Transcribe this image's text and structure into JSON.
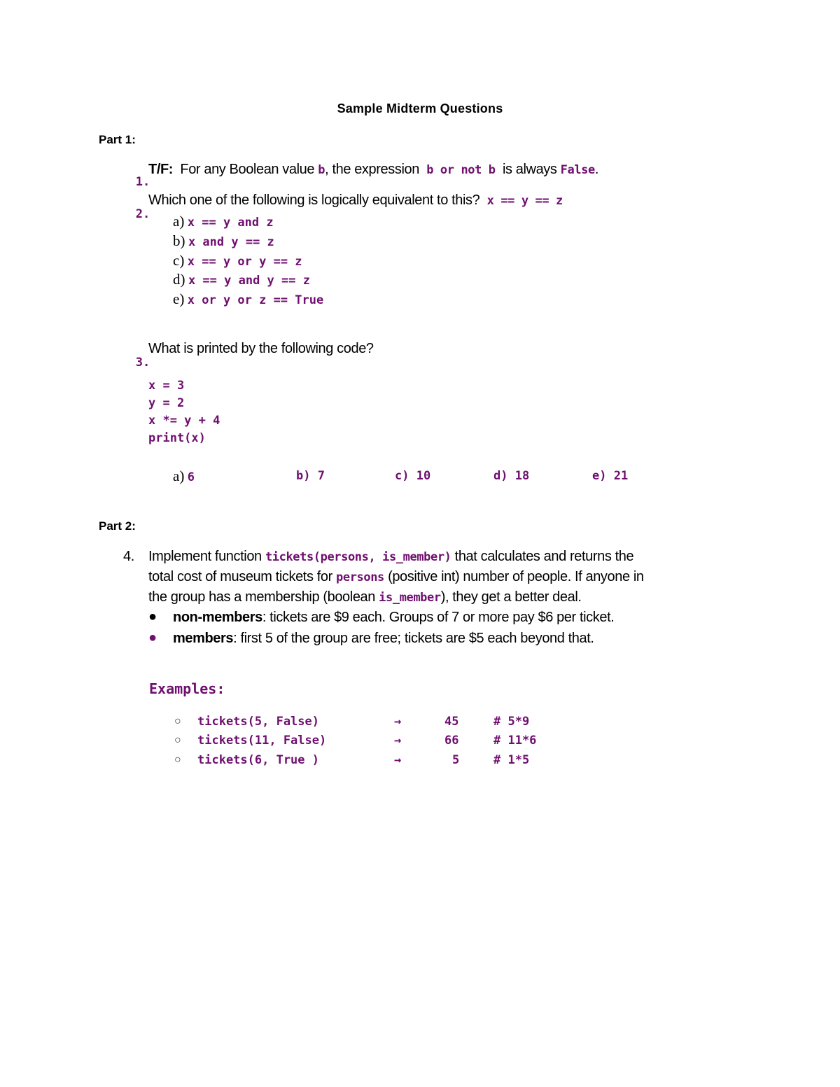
{
  "document": {
    "title": "Sample Midterm Questions",
    "part1_label": "Part 1:",
    "part2_label": "Part 2:"
  },
  "q1": {
    "number": "1.",
    "prefix": "T/F:",
    "text_a": "For any Boolean value",
    "code_b": "b",
    "text_b": ", the expression",
    "code_expr": "b or not b",
    "text_c": "is always",
    "code_false": "False",
    "text_d": "."
  },
  "q2": {
    "number": "2.",
    "text": "Which one of the following is logically equivalent to this?",
    "code_expr": "x == y == z",
    "options": [
      {
        "letter": "a)",
        "code": "x == y and z"
      },
      {
        "letter": "b)",
        "code": "x and y == z"
      },
      {
        "letter": "c)",
        "code": "x == y or y == z"
      },
      {
        "letter": "d)",
        "code": "x == y and y == z"
      },
      {
        "letter": "e)",
        "code": "x or y or z == True"
      }
    ]
  },
  "q3": {
    "number": "3.",
    "text": "What is printed by the following code?",
    "code_lines": [
      "x = 3",
      "y = 2",
      "x *= y + 4",
      "print(x)"
    ],
    "answers": [
      {
        "letter": "a)",
        "value": "6"
      },
      {
        "letter": "b)",
        "value": "7"
      },
      {
        "letter": "c)",
        "value": "10"
      },
      {
        "letter": "d)",
        "value": "18"
      },
      {
        "letter": "e)",
        "value": "21"
      }
    ]
  },
  "q4": {
    "number": "4.",
    "line1_text": "Implement function",
    "line1_code": "tickets(persons, is_member)",
    "line1_tail": "that calculates and returns the",
    "line2_text": "total cost of museum tickets for",
    "line2_code": "persons",
    "line2_tail": "(positive int) number of people. If anyone in",
    "line3_text": "the group has a membership (boolean",
    "line3_code": "is_member",
    "line3_tail": "), they get a better deal.",
    "bullets": [
      {
        "label": "non-members",
        "text": ": tickets are $9 each. Groups of 7 or more pay $6 per ticket."
      },
      {
        "label": "members",
        "text": ": first 5 of the group are free; tickets are $5 each beyond that."
      }
    ],
    "examples_label": "Examples:",
    "examples": [
      {
        "call": "tickets(5, False)",
        "arrow": "→",
        "result": "45",
        "comment": "# 5*9"
      },
      {
        "call": "tickets(11, False)",
        "arrow": "→",
        "result": "66",
        "comment": "# 11*6"
      },
      {
        "call": "tickets(6, True )",
        "arrow": "→",
        "result": "5",
        "comment": "# 1*5"
      }
    ]
  },
  "colors": {
    "code_purple": "#6f0f6f",
    "text": "#000000"
  }
}
